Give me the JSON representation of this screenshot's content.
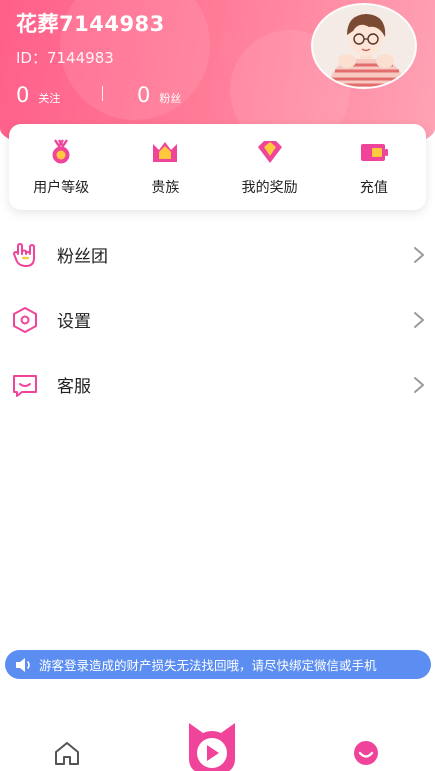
{
  "profile": {
    "name": "花葬7144983",
    "id_text": "ID：7144983",
    "follow_count": "0",
    "follow_label": "关注",
    "fans_count": "0",
    "fans_label": "粉丝"
  },
  "quick_actions": [
    {
      "label": "用户等级",
      "icon": "medal-icon"
    },
    {
      "label": "贵族",
      "icon": "crown-icon"
    },
    {
      "label": "我的奖励",
      "icon": "diamond-icon"
    },
    {
      "label": "充值",
      "icon": "battery-icon"
    }
  ],
  "menu": [
    {
      "label": "粉丝团",
      "icon": "rock-hand-icon"
    },
    {
      "label": "设置",
      "icon": "hexagon-settings-icon"
    },
    {
      "label": "客服",
      "icon": "chat-icon"
    }
  ],
  "notice": {
    "text": "游客登录造成的财产损失无法找回哦，请尽快绑定微信或手机"
  },
  "tabs": [
    {
      "name": "home",
      "icon": "home-icon"
    },
    {
      "name": "live",
      "icon": "cat-play-icon"
    },
    {
      "name": "me",
      "icon": "smile-icon"
    }
  ],
  "colors": {
    "brand_pink": "#ff5f8a",
    "icon_pink": "#f0449a",
    "icon_yellow": "#ffc83d",
    "notice_blue": "#5b8ef0"
  }
}
